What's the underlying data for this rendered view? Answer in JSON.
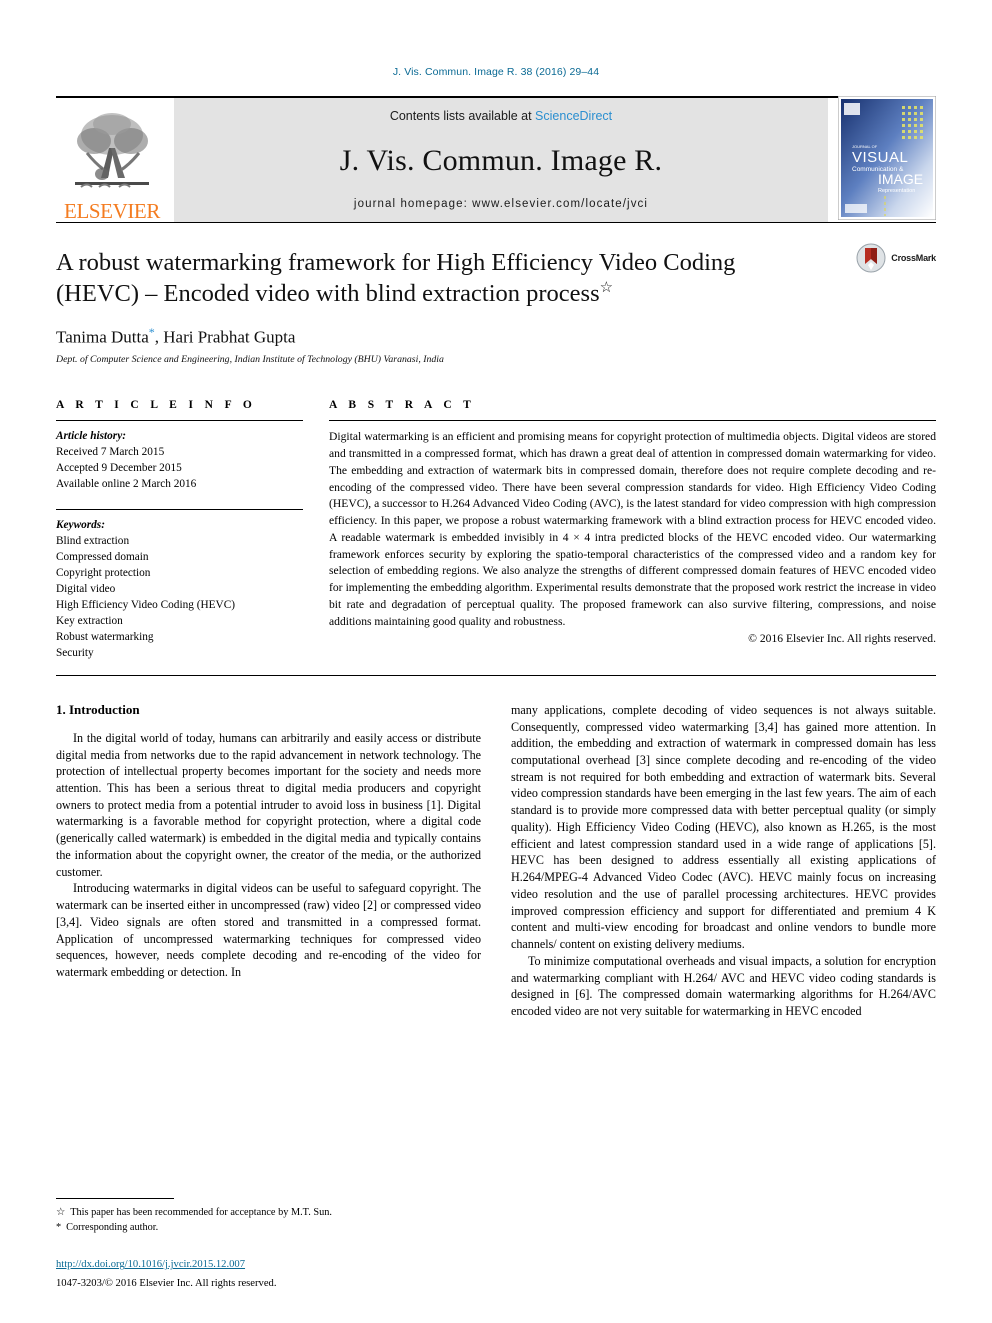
{
  "running_head": "J. Vis. Commun. Image R. 38 (2016) 29–44",
  "masthead": {
    "publisher_name": "ELSEVIER",
    "contents_prefix": "Contents lists available at ",
    "contents_link": "ScienceDirect",
    "journal_title": "J. Vis. Commun. Image R.",
    "homepage_line": "journal homepage: www.elsevier.com/locate/jvci",
    "cover_title_lines": [
      "JOURNAL OF",
      "VISUAL",
      "Communication &",
      "IMAGE",
      "Representation"
    ]
  },
  "title_block": {
    "title_line1": "A robust watermarking framework for High Efficiency Video Coding",
    "title_line2": "(HEVC) – Encoded video with blind extraction process",
    "title_mark": "☆",
    "authors_part1": "Tanima Dutta",
    "authors_star": "*",
    "authors_part2": ", Hari Prabhat Gupta",
    "affiliation": "Dept. of Computer Science and Engineering, Indian Institute of Technology (BHU) Varanasi, India",
    "crossmark_label": "CrossMark"
  },
  "article_info": {
    "heading": "A R T I C L E  I N F O",
    "history_label": "Article history:",
    "history": [
      "Received 7 March 2015",
      "Accepted 9 December 2015",
      "Available online 2 March 2016"
    ],
    "keywords_label": "Keywords:",
    "keywords": [
      "Blind extraction",
      "Compressed domain",
      "Copyright protection",
      "Digital video",
      "High Efficiency Video Coding (HEVC)",
      "Key extraction",
      "Robust watermarking",
      "Security"
    ]
  },
  "abstract": {
    "heading": "A B S T R A C T",
    "text": "Digital watermarking is an efficient and promising means for copyright protection of multimedia objects. Digital videos are stored and transmitted in a compressed format, which has drawn a great deal of attention in compressed domain watermarking for video. The embedding and extraction of watermark bits in compressed domain, therefore does not require complete decoding and re-encoding of the compressed video. There have been several compression standards for video. High Efficiency Video Coding (HEVC), a successor to H.264 Advanced Video Coding (AVC), is the latest standard for video compression with high compression efficiency. In this paper, we propose a robust watermarking framework with a blind extraction process for HEVC encoded video. A readable watermark is embedded invisibly in 4 × 4 intra predicted blocks of the HEVC encoded video. Our watermarking framework enforces security by exploring the spatio-temporal characteristics of the compressed video and a random key for selection of embedding regions. We also analyze the strengths of different compressed domain features of HEVC encoded video for implementing the embedding algorithm. Experimental results demonstrate that the proposed work restrict the increase in video bit rate and degradation of perceptual quality. The proposed framework can also survive filtering, compressions, and noise additions maintaining good quality and robustness.",
    "copyright": "© 2016 Elsevier Inc. All rights reserved."
  },
  "body": {
    "section_heading": "1. Introduction",
    "left_paragraphs": [
      "In the digital world of today, humans can arbitrarily and easily access or distribute digital media from networks due to the rapid advancement in network technology. The protection of intellectual property becomes important for the society and needs more attention. This has been a serious threat to digital media producers and copyright owners to protect media from a potential intruder to avoid loss in business [1]. Digital watermarking is a favorable method for copyright protection, where a digital code (generically called watermark) is embedded in the digital media and typically contains the information about the copyright owner, the creator of the media, or the authorized customer.",
      "Introducing watermarks in digital videos can be useful to safeguard copyright. The watermark can be inserted either in uncompressed (raw) video [2] or compressed video [3,4]. Video signals are often stored and transmitted in a compressed format. Application of uncompressed watermarking techniques for compressed video sequences, however, needs complete decoding and re-encoding of the video for watermark embedding or detection. In"
    ],
    "right_paragraphs": [
      "many applications, complete decoding of video sequences is not always suitable. Consequently, compressed video watermarking [3,4] has gained more attention. In addition, the embedding and extraction of watermark in compressed domain has less computational overhead [3] since complete decoding and re-encoding of the video stream is not required for both embedding and extraction of watermark bits. Several video compression standards have been emerging in the last few years. The aim of each standard is to provide more compressed data with better perceptual quality (or simply quality). High Efficiency Video Coding (HEVC), also known as H.265, is the most efficient and latest compression standard used in a wide range of applications [5]. HEVC has been designed to address essentially all existing applications of H.264/MPEG-4 Advanced Video Codec (AVC). HEVC mainly focus on increasing video resolution and the use of parallel processing architectures. HEVC provides improved compression efficiency and support for differentiated and premium 4 K content and multi-view encoding for broadcast and online vendors to bundle more channels/ content on existing delivery mediums.",
      "To minimize computational overheads and visual impacts, a solution for encryption and watermarking compliant with H.264/ AVC and HEVC video coding standards is designed in [6]. The compressed domain watermarking algorithms for H.264/AVC encoded video are not very suitable for watermarking in HEVC encoded"
    ]
  },
  "footnotes": {
    "note1_mark": "☆",
    "note1_text": "This paper has been recommended for acceptance by M.T. Sun.",
    "note2_mark": "*",
    "note2_text": "Corresponding author.",
    "doi_url": "http://dx.doi.org/10.1016/j.jvcir.2015.12.007",
    "issn_line": "1047-3203/© 2016 Elsevier Inc. All rights reserved."
  },
  "colors": {
    "link_blue": "#0b6a94",
    "sciencedirect_blue": "#2b8fd0",
    "elsevier_orange": "#f47c20",
    "masthead_gray": "#e3e3e3"
  }
}
